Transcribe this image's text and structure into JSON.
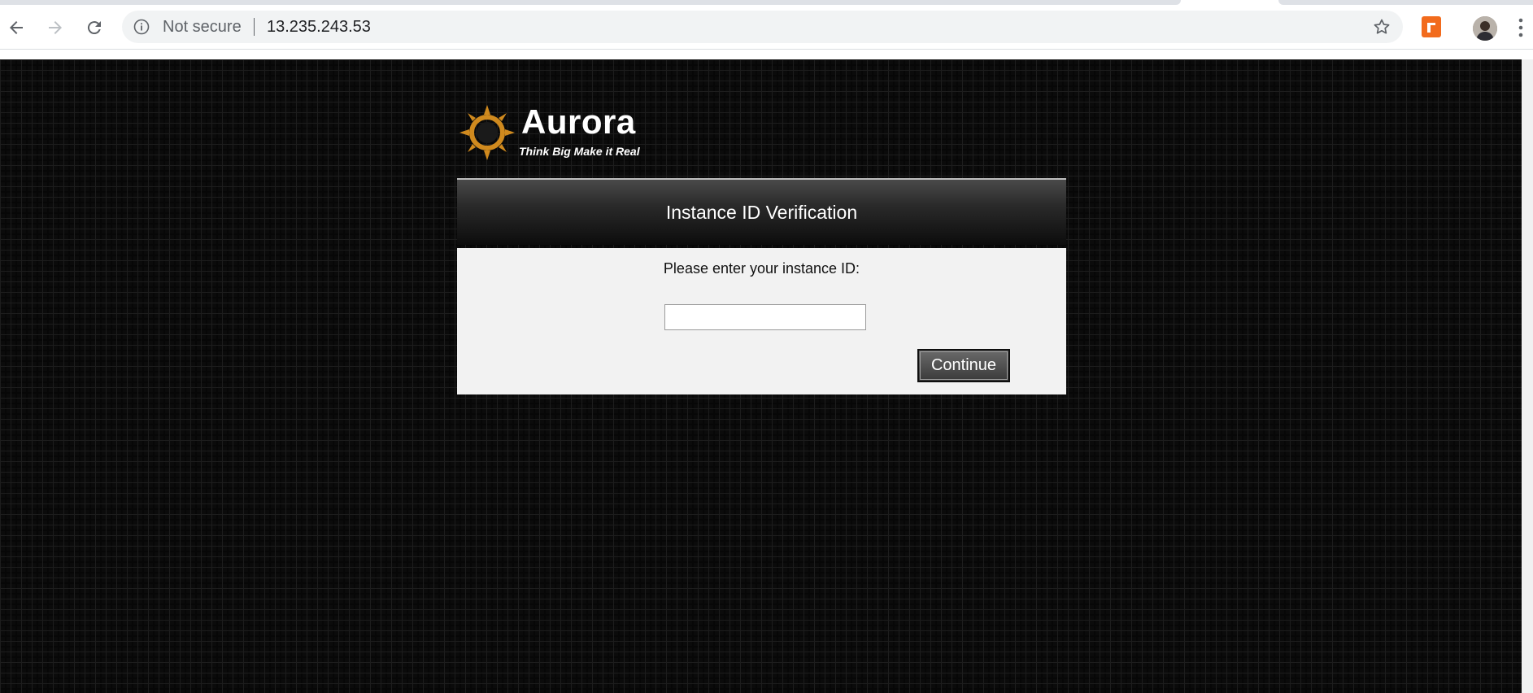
{
  "browser": {
    "security_label": "Not secure",
    "url": "13.235.243.53"
  },
  "page": {
    "logo": {
      "name": "Aurora",
      "tagline": "Think Big Make it Real"
    },
    "dialog": {
      "title": "Instance ID Verification",
      "prompt": "Please enter your instance ID:",
      "instance_id_value": "",
      "continue_label": "Continue"
    }
  },
  "colors": {
    "logo_sun": "#d08a1e",
    "page_background": "#0b0b0b",
    "dialog_body": "#f2f2f2",
    "extension_accent": "#f26b1d"
  },
  "icons": [
    "back-arrow-icon",
    "forward-arrow-icon",
    "reload-icon",
    "info-icon",
    "star-icon",
    "extension-icon",
    "profile-avatar",
    "menu-dots-icon",
    "sun-logo-icon"
  ]
}
